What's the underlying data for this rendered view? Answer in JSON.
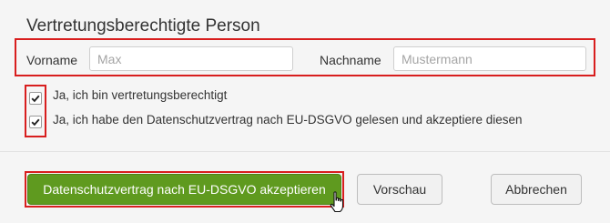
{
  "section": {
    "title": "Vertretungsberechtigte Person"
  },
  "form": {
    "first_name_label": "Vorname",
    "first_name_placeholder": "Max",
    "first_name_value": "",
    "last_name_label": "Nachname",
    "last_name_placeholder": "Mustermann",
    "last_name_value": ""
  },
  "checkboxes": [
    {
      "label": "Ja, ich bin vertretungsberechtigt",
      "checked": true
    },
    {
      "label": "Ja, ich habe den Datenschutzvertrag nach EU-DSGVO gelesen und akzeptiere diesen",
      "checked": true
    }
  ],
  "buttons": {
    "accept_label": "Datenschutzvertrag nach EU-DSGVO akzeptieren",
    "preview_label": "Vorschau",
    "cancel_label": "Abbrechen"
  },
  "colors": {
    "accent_green": "#5f9a1f",
    "highlight_red": "#d81e1e"
  },
  "icons": {
    "checkbox_check": "check-icon",
    "cursor": "hand-pointer-icon"
  }
}
